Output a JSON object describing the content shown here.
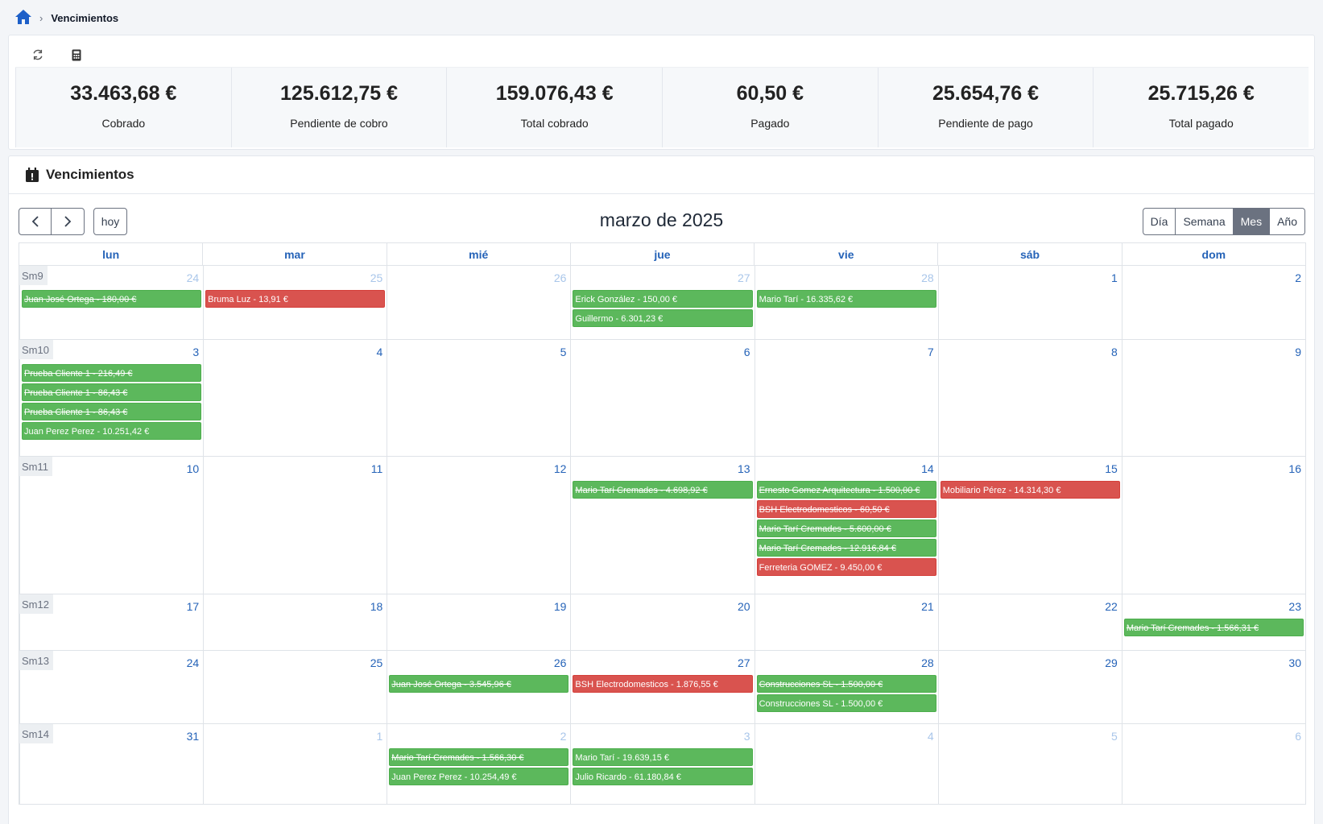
{
  "breadcrumb": {
    "current": "Vencimientos"
  },
  "toolbar": {
    "refresh_icon": "refresh-icon",
    "calculator_icon": "calculator-icon"
  },
  "stats": [
    {
      "value": "33.463,68 €",
      "label": "Cobrado"
    },
    {
      "value": "125.612,75 €",
      "label": "Pendiente de cobro"
    },
    {
      "value": "159.076,43 €",
      "label": "Total cobrado"
    },
    {
      "value": "60,50 €",
      "label": "Pagado"
    },
    {
      "value": "25.654,76 €",
      "label": "Pendiente de pago"
    },
    {
      "value": "25.715,26 €",
      "label": "Total pagado"
    }
  ],
  "calendar": {
    "panel_title": "Vencimientos",
    "title": "marzo de 2025",
    "today_label": "hoy",
    "views": [
      "Día",
      "Semana",
      "Mes",
      "Año"
    ],
    "active_view": "Mes",
    "weekdays": [
      "lun",
      "mar",
      "mié",
      "jue",
      "vie",
      "sáb",
      "dom"
    ],
    "colors": {
      "paid": "#5cb85c",
      "pending_payment": "#d9534f",
      "day_number": "#2563b8"
    },
    "weeks": [
      {
        "label": "Sm9",
        "days": [
          {
            "num": "24",
            "other": true,
            "events": [
              {
                "text": "Juan José Ortega - 180,00 €",
                "color": "green",
                "strike": true
              }
            ]
          },
          {
            "num": "25",
            "other": true,
            "events": [
              {
                "text": "Bruma Luz - 13,91 €",
                "color": "red",
                "strike": false
              }
            ]
          },
          {
            "num": "26",
            "other": true,
            "events": []
          },
          {
            "num": "27",
            "other": true,
            "events": [
              {
                "text": "Erick González - 150,00 €",
                "color": "green",
                "strike": false
              },
              {
                "text": "Guillermo - 6.301,23 €",
                "color": "green",
                "strike": false
              }
            ]
          },
          {
            "num": "28",
            "other": true,
            "events": [
              {
                "text": "Mario Tarí - 16.335,62 €",
                "color": "green",
                "strike": false
              }
            ]
          },
          {
            "num": "1",
            "other": false,
            "events": []
          },
          {
            "num": "2",
            "other": false,
            "events": []
          }
        ]
      },
      {
        "label": "Sm10",
        "days": [
          {
            "num": "3",
            "other": false,
            "events": [
              {
                "text": "Prueba Cliente 1 - 216,49 €",
                "color": "green",
                "strike": true
              },
              {
                "text": "Prueba Cliente 1 - 86,43 €",
                "color": "green",
                "strike": true
              },
              {
                "text": "Prueba Cliente 1 - 86,43 €",
                "color": "green",
                "strike": true
              },
              {
                "text": "Juan Perez Perez - 10.251,42 €",
                "color": "green",
                "strike": false
              }
            ]
          },
          {
            "num": "4",
            "other": false,
            "events": []
          },
          {
            "num": "5",
            "other": false,
            "events": []
          },
          {
            "num": "6",
            "other": false,
            "events": []
          },
          {
            "num": "7",
            "other": false,
            "events": []
          },
          {
            "num": "8",
            "other": false,
            "events": []
          },
          {
            "num": "9",
            "other": false,
            "events": []
          }
        ]
      },
      {
        "label": "Sm11",
        "days": [
          {
            "num": "10",
            "other": false,
            "events": []
          },
          {
            "num": "11",
            "other": false,
            "events": []
          },
          {
            "num": "12",
            "other": false,
            "events": []
          },
          {
            "num": "13",
            "other": false,
            "events": [
              {
                "text": "Mario Tarí Cremades - 4.698,92 €",
                "color": "green",
                "strike": true
              }
            ]
          },
          {
            "num": "14",
            "other": false,
            "events": [
              {
                "text": "Ernesto Gomez Arquitectura - 1.500,00 €",
                "color": "green",
                "strike": true
              },
              {
                "text": "BSH Electrodomesticos - 60,50 €",
                "color": "red",
                "strike": true
              },
              {
                "text": "Mario Tarí Cremades - 5.600,00 €",
                "color": "green",
                "strike": true
              },
              {
                "text": "Mario Tarí Cremades - 12.916,84 €",
                "color": "green",
                "strike": true
              },
              {
                "text": "Ferreteria GOMEZ - 9.450,00 €",
                "color": "red",
                "strike": false
              }
            ]
          },
          {
            "num": "15",
            "other": false,
            "events": [
              {
                "text": "Mobiliario Pérez - 14.314,30 €",
                "color": "red",
                "strike": false
              }
            ]
          },
          {
            "num": "16",
            "other": false,
            "events": []
          }
        ]
      },
      {
        "label": "Sm12",
        "days": [
          {
            "num": "17",
            "other": false,
            "events": []
          },
          {
            "num": "18",
            "other": false,
            "events": []
          },
          {
            "num": "19",
            "other": false,
            "events": []
          },
          {
            "num": "20",
            "other": false,
            "events": []
          },
          {
            "num": "21",
            "other": false,
            "events": []
          },
          {
            "num": "22",
            "other": false,
            "events": []
          },
          {
            "num": "23",
            "other": false,
            "events": [
              {
                "text": "Mario Tarí Cremades - 1.566,31 €",
                "color": "green",
                "strike": true
              }
            ]
          }
        ]
      },
      {
        "label": "Sm13",
        "days": [
          {
            "num": "24",
            "other": false,
            "events": []
          },
          {
            "num": "25",
            "other": false,
            "events": []
          },
          {
            "num": "26",
            "other": false,
            "events": [
              {
                "text": "Juan José Ortega - 3.545,96 €",
                "color": "green",
                "strike": true
              }
            ]
          },
          {
            "num": "27",
            "other": false,
            "events": [
              {
                "text": "BSH Electrodomesticos - 1.876,55 €",
                "color": "red",
                "strike": false
              }
            ]
          },
          {
            "num": "28",
            "other": false,
            "events": [
              {
                "text": "Construcciones SL - 1.500,00 €",
                "color": "green",
                "strike": true
              },
              {
                "text": "Construcciones SL - 1.500,00 €",
                "color": "green",
                "strike": false
              }
            ]
          },
          {
            "num": "29",
            "other": false,
            "events": []
          },
          {
            "num": "30",
            "other": false,
            "events": []
          }
        ]
      },
      {
        "label": "Sm14",
        "days": [
          {
            "num": "31",
            "other": false,
            "events": []
          },
          {
            "num": "1",
            "other": true,
            "events": []
          },
          {
            "num": "2",
            "other": true,
            "events": [
              {
                "text": "Mario Tarí Cremades - 1.566,30 €",
                "color": "green",
                "strike": true
              },
              {
                "text": "Juan Perez Perez - 10.254,49 €",
                "color": "green",
                "strike": false
              }
            ]
          },
          {
            "num": "3",
            "other": true,
            "events": [
              {
                "text": "Mario Tarí - 19.639,15 €",
                "color": "green",
                "strike": false
              },
              {
                "text": "Julio Ricardo - 61.180,84 €",
                "color": "green",
                "strike": false
              }
            ]
          },
          {
            "num": "4",
            "other": true,
            "events": []
          },
          {
            "num": "5",
            "other": true,
            "events": []
          },
          {
            "num": "6",
            "other": true,
            "events": []
          }
        ]
      }
    ]
  }
}
